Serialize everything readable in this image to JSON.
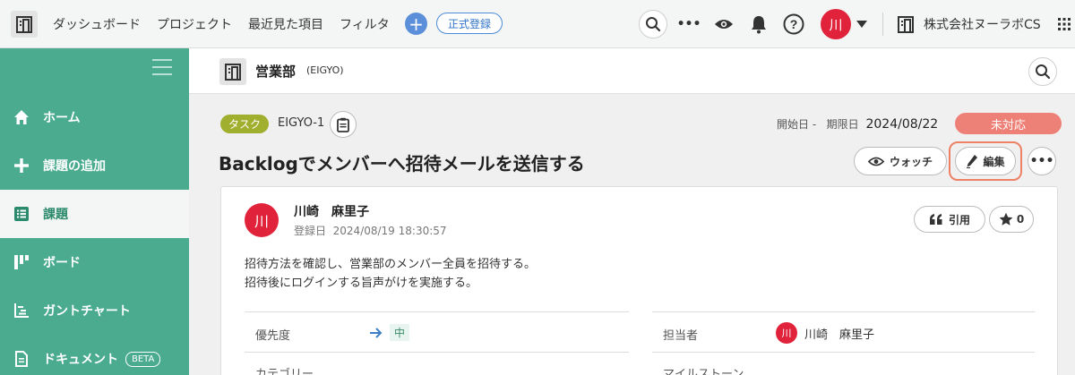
{
  "topbar": {
    "nav": [
      "ダッシュボード",
      "プロジェクト",
      "最近見た項目",
      "フィルタ"
    ],
    "plus_label": "+",
    "register_label": "正式登録",
    "more_label": "•••",
    "avatar_initial": "川",
    "org_name": "株式会社ヌーラボCS"
  },
  "sidebar": {
    "items": [
      {
        "label": "ホーム",
        "icon": "home-icon"
      },
      {
        "label": "課題の追加",
        "icon": "plus-icon"
      },
      {
        "label": "課題",
        "icon": "list-icon",
        "active": true
      },
      {
        "label": "ボード",
        "icon": "board-icon"
      },
      {
        "label": "ガントチャート",
        "icon": "gantt-icon"
      },
      {
        "label": "ドキュメント",
        "icon": "document-icon",
        "badge": "BETA"
      }
    ]
  },
  "project": {
    "name": "営業部",
    "key": "(EIGYO)"
  },
  "issue": {
    "type": "タスク",
    "key": "EIGYO-1",
    "start_label": "開始日",
    "start_value": "-",
    "due_label": "期限日",
    "due_value": "2024/08/22",
    "status": "未対応",
    "title": "Backlogでメンバーへ招待メールを送信する",
    "watch_label": "ウォッチ",
    "edit_label": "編集",
    "more_label": "•••"
  },
  "detail": {
    "avatar_initial": "川",
    "author": "川崎　麻里子",
    "registered_label": "登録日",
    "registered_date": "2024/08/19 18:30:57",
    "quote_label": "引用",
    "star_count": "0",
    "description": [
      "招待方法を確認し、営業部のメンバー全員を招待する。",
      "招待後にログインする旨声がけを実施する。"
    ],
    "priority_label": "優先度",
    "priority_value": "中",
    "assignee_label": "担当者",
    "assignee_initial": "川",
    "assignee_name": "川崎　麻里子",
    "category_label": "カテゴリー",
    "milestone_label": "マイルストーン"
  },
  "colors": {
    "sidebar": "#4aab8e",
    "accent_red": "#e0233b",
    "status": "#ed8077",
    "task_tag": "#a1af2f",
    "edit_highlight": "#ee8064"
  }
}
